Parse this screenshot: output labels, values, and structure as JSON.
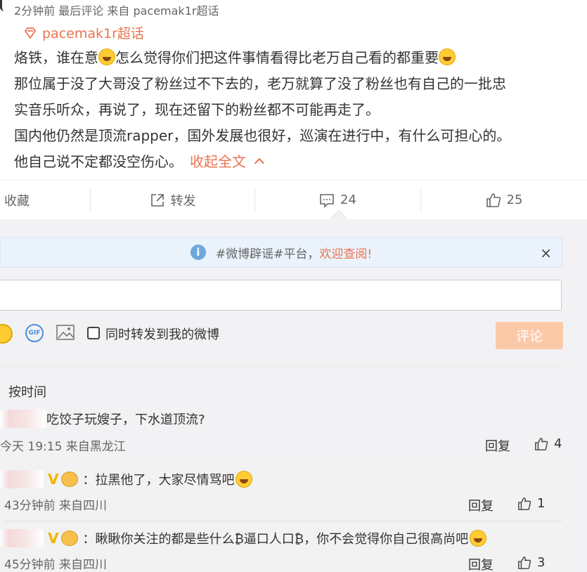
{
  "post": {
    "meta": "2分钟前 最后评论 来自 pacemak1r超话",
    "supertopic": "pacemak1r超话",
    "lines": [
      "烙铁，谁在意",
      "怎么觉得你们把这件事情看得比老万自己看的都重要",
      "那位属于没了大哥没了粉丝过不下去的，老万就算了没了粉丝也有自己的一批忠",
      "实音乐听众，再说了，现在还留下的粉丝都不可能再走了。",
      "国内他仍然是顶流rapper，国外发展也很好，巡演在进行中，有什么可担心的。",
      "他自己说不定都没空伤心。"
    ],
    "collapse_label": "收起全文"
  },
  "actions": {
    "favorite": "收藏",
    "repost": "转发",
    "comments": "24",
    "likes": "25"
  },
  "notice": {
    "prefix": "#微博辟谣#平台，",
    "highlight": "欢迎查阅!",
    "close": "×"
  },
  "composer": {
    "gif": "GIF",
    "checkbox_label": "同时转发到我的微博",
    "submit": "评论"
  },
  "sort_label": "按时间",
  "comments": [
    {
      "text": "吃饺子玩嫂子，下水道顶流?",
      "meta": "今天 19:15 来自黑龙江",
      "reply": "回复",
      "likes": "4"
    }
  ],
  "replies": [
    {
      "badge": "V",
      "text": "：拉黑他了，大家尽情骂吧",
      "meta": "43分钟前 来自四川",
      "reply": "回复",
      "likes": "1"
    },
    {
      "badge": "V",
      "text": "：瞅瞅你关注的都是些什么₿逼口人口₿，你不会觉得你自己很高尚吧",
      "meta": "45分钟前 来自四川",
      "reply": "回复",
      "likes": "3"
    }
  ],
  "colors": {
    "accent": "#eb7350",
    "submit_bg": "#fcc9a8",
    "notice_bg": "#eaf3fb"
  }
}
